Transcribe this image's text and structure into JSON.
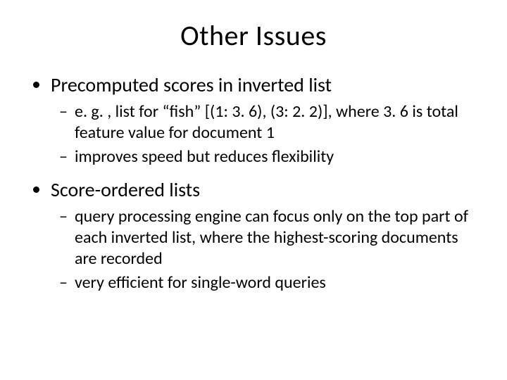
{
  "title": "Other Issues",
  "bullets": [
    {
      "text": "Precomputed scores in inverted list",
      "sub": [
        "e. g. , list for “fish” [(1: 3. 6), (3: 2. 2)], where 3. 6 is total feature value for document 1",
        "improves speed but reduces flexibility"
      ]
    },
    {
      "text": "Score-ordered lists",
      "sub": [
        "query processing engine can focus only on the top part of each inverted list, where the highest-scoring documents are recorded",
        "very efficient for single-word queries"
      ]
    }
  ]
}
